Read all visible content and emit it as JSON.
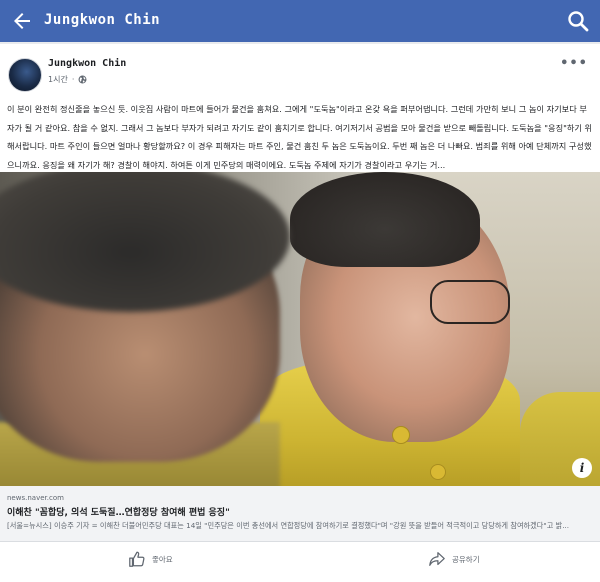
{
  "header": {
    "title": "Jungkwon Chin",
    "back_icon": "arrow-left-icon",
    "search_icon": "search-icon",
    "bg_color": "#4267b2"
  },
  "post": {
    "author": "Jungkwon Chin",
    "time": "1시간",
    "separator": "·",
    "privacy_icon": "globe-icon",
    "more_label": "•••",
    "body": "이 분이 완전히 정신줄을 놓으신 듯. 이웃집 사람이 마트에 들어가 물건을 훔쳐요. 그에게 \"도둑놈\"이라고 온갖 욕을 퍼부어댑니다. 그런데 가만히 보니 그 놈이 자기보다 부자가 될 거 같아요. 참을 수 없지. 그래서 그 놈보다 부자가 되려고 자기도 같이 훔치기로 합니다. 여기저기서 공범을 모아 물건을 받으로 빼돌립니다. 도둑놈을 \"응징\"하기 위해서랍니다. 마트 주인이 들으면 얼마나 황당할까요? 이 경우 피해자는 마트 주인, 물건 훔친 두 놈은 도둑놈이요. 두번 째 놈은 더 나빠요. 범죄를 위해 아예 단체까지 구성했으니까요. 응징을 왜 자기가 해? 경찰이 해야지. 하여튼 이게 민주당의 매력이에요. 도둑놈 주제에 자기가 경찰이라고 우기는 거..."
  },
  "link": {
    "domain": "news.naver.com",
    "title": "이해찬 \"꼼합당, 의석 도둑질…연합정당 참여해 편법 응징\"",
    "description": "[서울=뉴시스] 이승주 기자 = 이해찬 더불어민주당 대표는 14일 \"민주당은 이번 총선에서 연합정당에 참여하기로 결정했다\"며 \"강원 뜻을 받들어 적극적이고 당당하게 참여하겠다\"고 밝..."
  },
  "actions": {
    "like_label": "좋아요",
    "share_label": "공유하기",
    "like_icon": "thumbs-up-icon",
    "share_icon": "share-arrow-icon"
  },
  "photo": {
    "info_label": "i",
    "info_icon": "info-icon"
  }
}
